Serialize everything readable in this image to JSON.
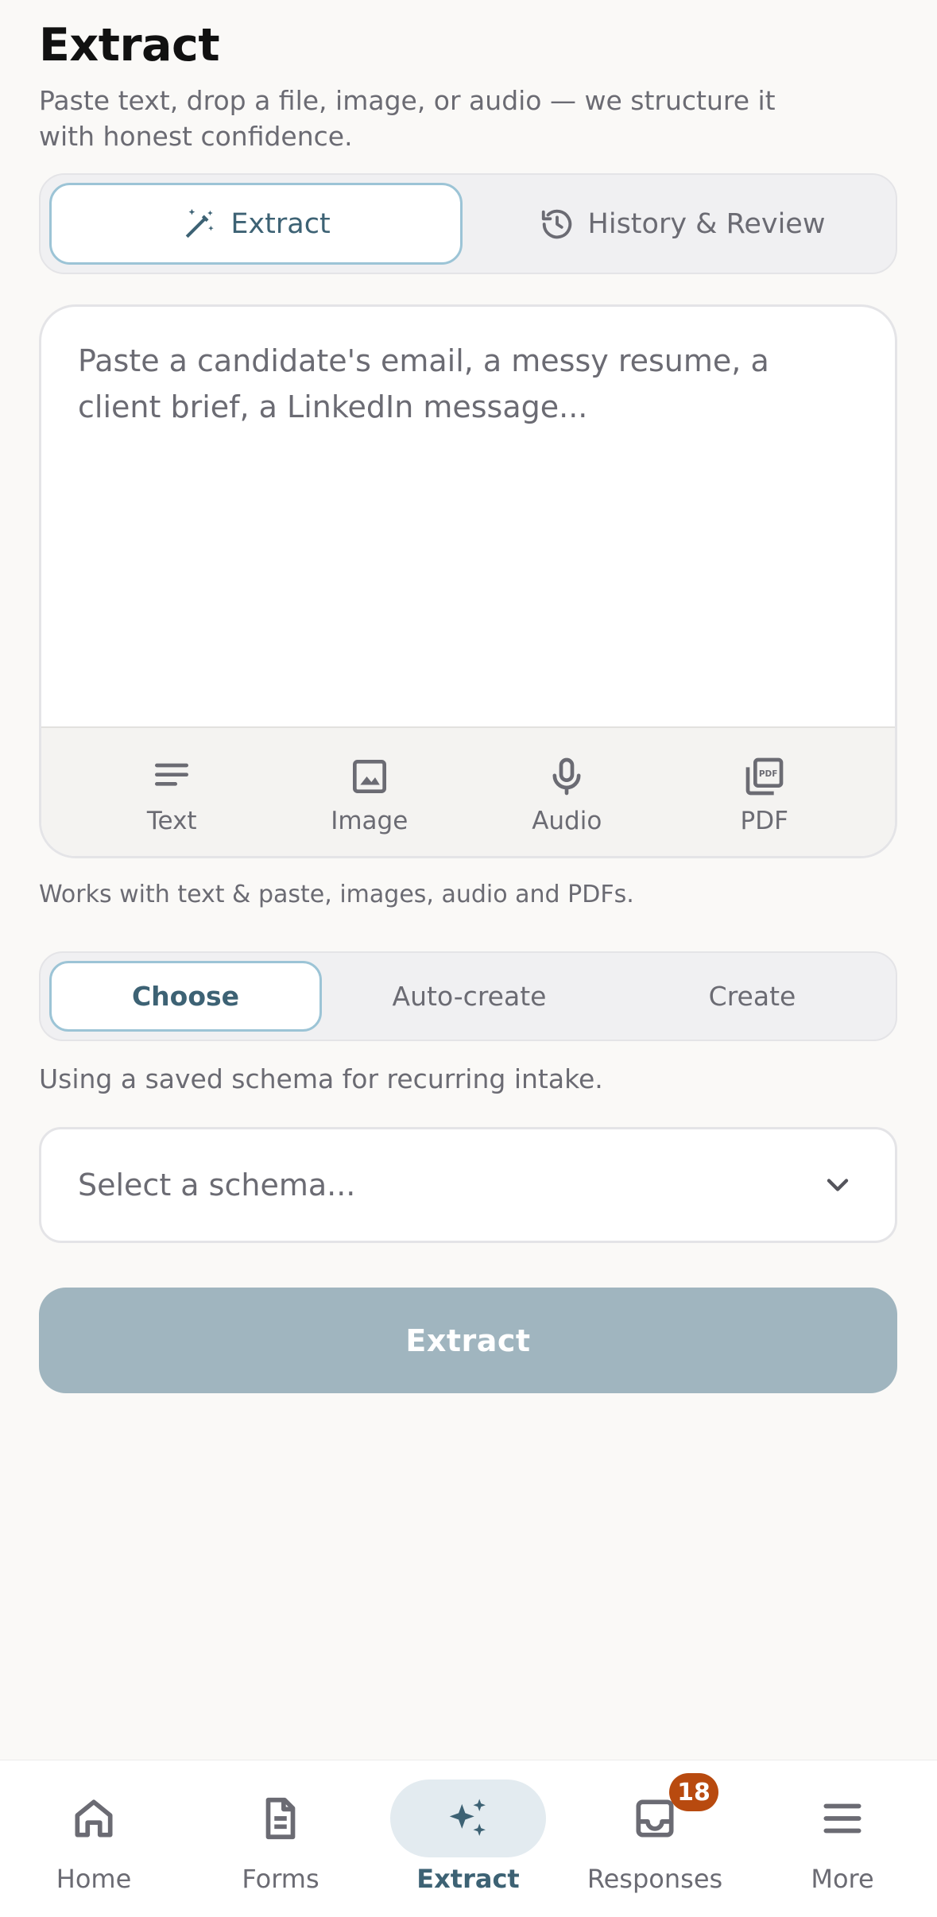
{
  "header": {
    "title": "Extract",
    "subtitle": "Paste text, drop a file, image, or audio — we structure it with honest confidence."
  },
  "mode_tabs": [
    {
      "label": "Extract",
      "icon": "magic-wand-icon",
      "active": true
    },
    {
      "label": "History & Review",
      "icon": "history-icon",
      "active": false
    }
  ],
  "input": {
    "placeholder": "Paste a candidate's email, a messy resume, a client brief, a LinkedIn message..."
  },
  "input_tools": [
    {
      "label": "Text",
      "icon": "text-lines-icon"
    },
    {
      "label": "Image",
      "icon": "image-icon"
    },
    {
      "label": "Audio",
      "icon": "microphone-icon"
    },
    {
      "label": "PDF",
      "icon": "pdf-icon"
    }
  ],
  "works_note": "Works with text & paste, images, audio and PDFs.",
  "schema_tabs": [
    {
      "label": "Choose",
      "active": true
    },
    {
      "label": "Auto-create",
      "active": false
    },
    {
      "label": "Create",
      "active": false
    }
  ],
  "schema_note": "Using a saved schema for recurring intake.",
  "schema_select": {
    "placeholder": "Select a schema..."
  },
  "extract_button": {
    "label": "Extract",
    "disabled": true
  },
  "bottom_nav": [
    {
      "label": "Home",
      "icon": "home-icon",
      "active": false
    },
    {
      "label": "Forms",
      "icon": "document-icon",
      "active": false
    },
    {
      "label": "Extract",
      "icon": "sparkles-icon",
      "active": true
    },
    {
      "label": "Responses",
      "icon": "inbox-icon",
      "active": false,
      "badge": "18"
    },
    {
      "label": "More",
      "icon": "menu-icon",
      "active": false
    }
  ],
  "colors": {
    "accent": "#3d6274",
    "accent_border": "#9cc4d6",
    "disabled_button": "#a0b5bf",
    "badge": "#b84a0f",
    "background": "#faf9f7"
  }
}
